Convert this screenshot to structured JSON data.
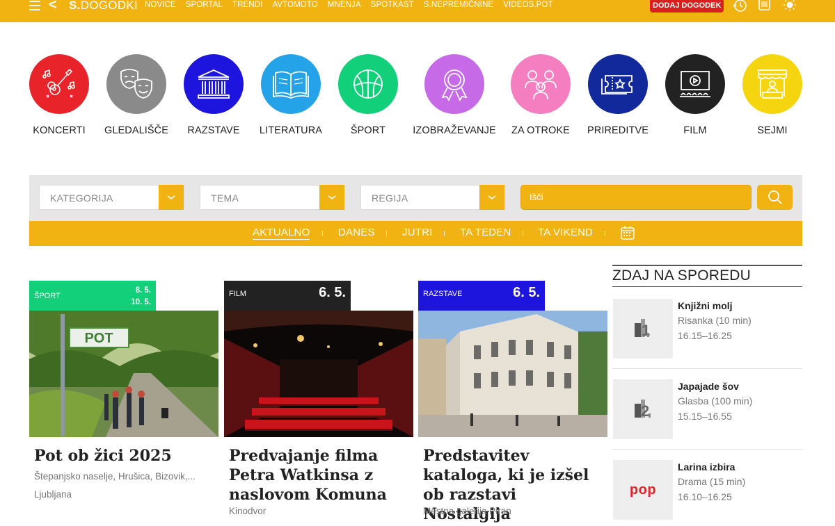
{
  "topbar": {
    "logo_bold": "S.",
    "logo_rest": "DOGODKI",
    "nav": [
      "NOVICE",
      "SPORTAL",
      "TRENDI",
      "AVTOMOTO",
      "MNENJA",
      "SPOTKAST",
      "S.NEPREMIČNINE",
      "VIDEOS.POT"
    ],
    "add_event": "DODAJ DOGODEK",
    "icons": [
      "menu-icon",
      "back-icon",
      "history-icon",
      "tv-icon",
      "brightness-icon"
    ],
    "accent": "#f0b312",
    "add_color": "#d8201f"
  },
  "categories": [
    {
      "label": "KONCERTI",
      "color": "#e8232a",
      "icon": "guitar-icon"
    },
    {
      "label": "GLEDALIŠČE",
      "color": "#8a8a8a",
      "icon": "theatre-masks-icon"
    },
    {
      "label": "RAZSTAVE",
      "color": "#1d14dd",
      "icon": "museum-icon"
    },
    {
      "label": "LITERATURA",
      "color": "#25a3e8",
      "icon": "open-book-icon"
    },
    {
      "label": "ŠPORT",
      "color": "#12cf7a",
      "icon": "ball-icon"
    },
    {
      "label": "IZOBRAŽEVANJE",
      "color": "#c66ae8",
      "icon": "award-icon"
    },
    {
      "label": "ZA OTROKE",
      "color": "#f47ec0",
      "icon": "family-icon"
    },
    {
      "label": "PRIREDITVE",
      "color": "#12299c",
      "icon": "ticket-icon"
    },
    {
      "label": "FILM",
      "color": "#222222",
      "icon": "cinema-icon"
    },
    {
      "label": "SEJMI",
      "color": "#f5d50f",
      "icon": "market-stall-icon"
    }
  ],
  "filters": {
    "category_placeholder": "KATEGORIJA",
    "topic_placeholder": "TEMA",
    "region_placeholder": "REGIJA",
    "search_placeholder": "Išči"
  },
  "time_tabs": [
    "AKTUALNO",
    "DANES",
    "JUTRI",
    "TA TEDEN",
    "TA VIKEND"
  ],
  "cards": [
    {
      "category": "ŠPORT",
      "color": "#12cf7a",
      "date_start": "8. 5.",
      "date_end": "10. 5.",
      "title": "Pot ob žici 2025",
      "location": "Štepanjsko naselje, Hrušica, Bizovik,...",
      "city": "Ljubljana"
    },
    {
      "category": "FILM",
      "color": "#222222",
      "date": "6. 5.",
      "title": "Predvajanje filma Petra Watkinsa z naslovom Komuna",
      "venue": "Kinodvor"
    },
    {
      "category": "RAZSTAVE",
      "color": "#1d14dd",
      "date": "6. 5.",
      "title": "Predstavitev kataloga, ki je izšel ob razstavi Nostalgija umetnika...",
      "venue": "Mestna galerija Piran"
    }
  ],
  "sidebar": {
    "title": "ZDAJ NA SPOREDU",
    "programs": [
      {
        "name": "Knjižni molj",
        "genre": "Risanka (10 min)",
        "time": "16.15–16.25",
        "channel_icon": "tv-slo-1-logo-icon"
      },
      {
        "name": "Japajade šov",
        "genre": "Glasba (100 min)",
        "time": "15.15–16.55",
        "channel_icon": "tv-slo-2-logo-icon"
      },
      {
        "name": "Larina izbira",
        "genre": "Drama (15 min)",
        "time": "16.10–16.25",
        "channel_icon": "pop-tv-logo-icon",
        "channel_text": "pop"
      }
    ]
  }
}
